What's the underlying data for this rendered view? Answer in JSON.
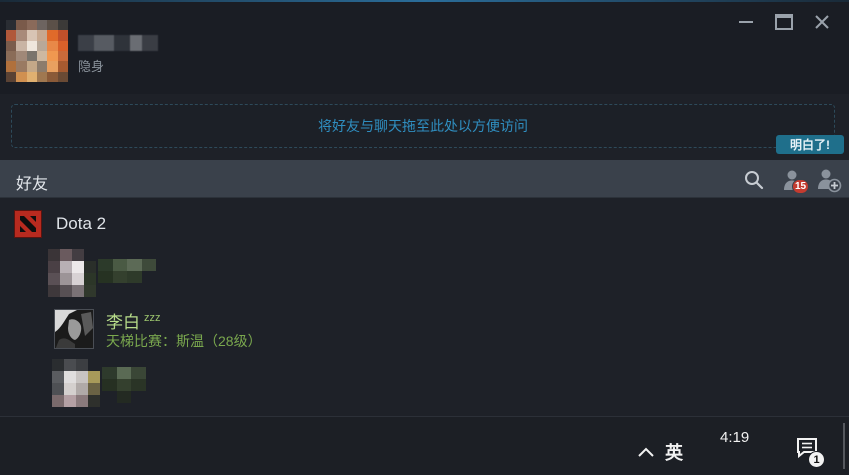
{
  "user": {
    "status": "隐身"
  },
  "window_controls": [
    "minimize",
    "maximize",
    "close"
  ],
  "dropzone": {
    "text": "将好友与聊天拖至此处以方便访问"
  },
  "tooltip": {
    "label": "明白了!"
  },
  "friends_bar": {
    "title": "好友",
    "search_icon": "search-icon",
    "pending_badge": "15",
    "add_friend_icon": "add-friend-icon"
  },
  "groups": [
    {
      "name": "Dota 2",
      "icon": "dota-icon",
      "friends": [
        {
          "name": "",
          "status": "",
          "blurred": true
        },
        {
          "name": "李白",
          "away": "zzz",
          "status": "天梯比赛：斯温（28级）",
          "blurred": false
        },
        {
          "name": "",
          "status": "",
          "blurred": true
        }
      ]
    }
  ],
  "taskbar": {
    "ime": "英",
    "time": "4:19",
    "notification_count": "1"
  },
  "colors": {
    "accent_link": "#2f8ec0",
    "ingame_green": "#b7dc8a",
    "badge_red": "#c43b2f",
    "friends_bar": "#3a414b"
  }
}
